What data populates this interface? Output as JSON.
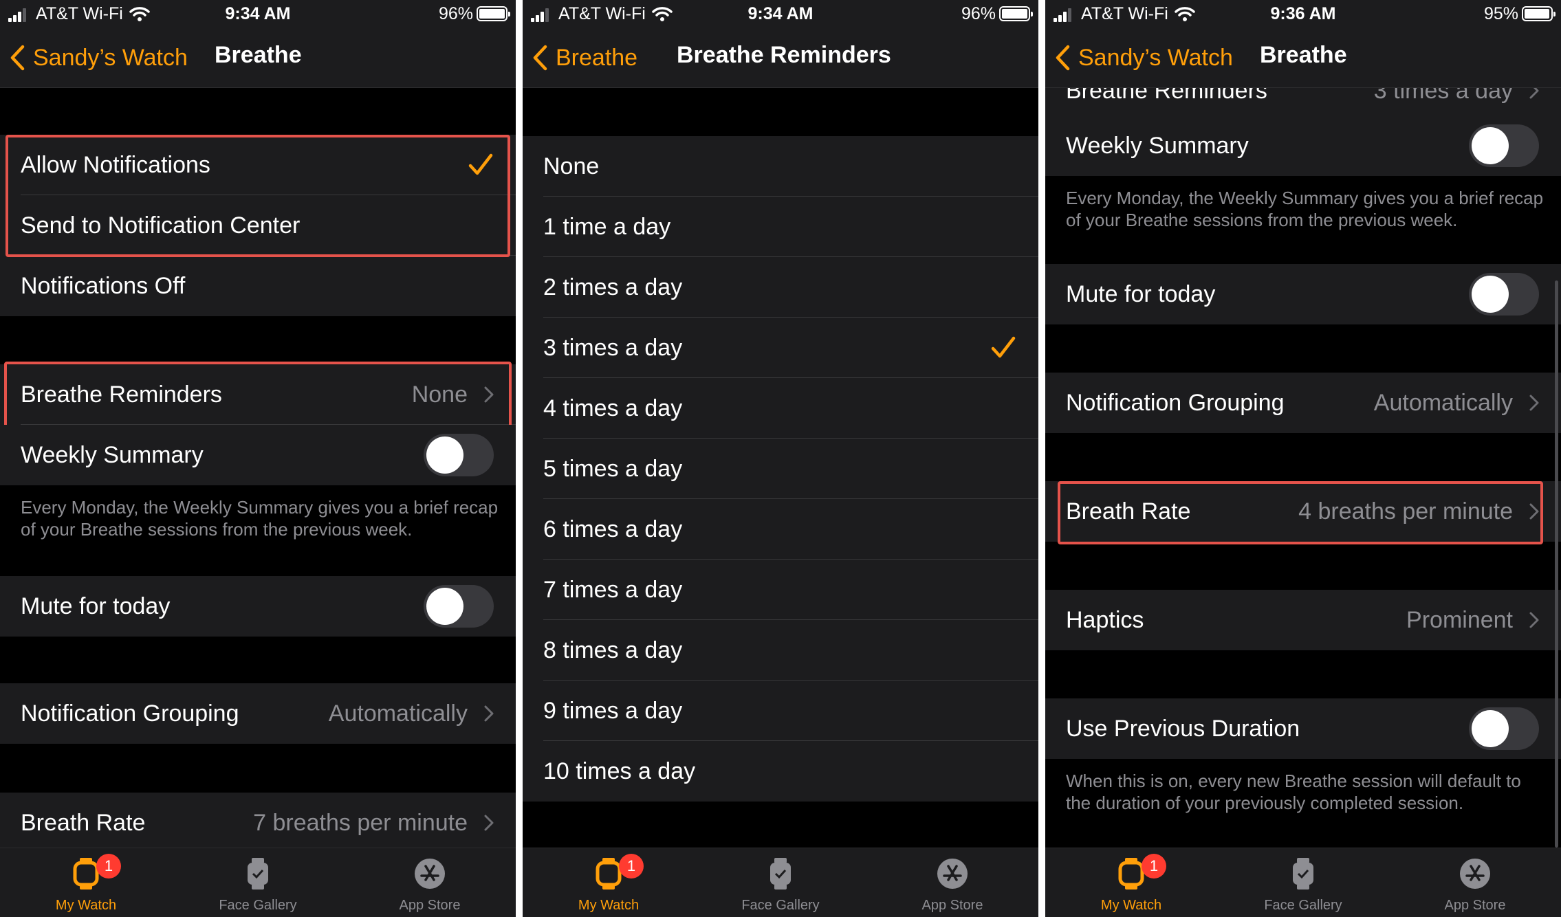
{
  "accent_color": "#ff9f0a",
  "highlight_color": "#e5534b",
  "screens": [
    {
      "status": {
        "carrier": "AT&T Wi-Fi",
        "time": "9:34 AM",
        "battery": "96%",
        "battery_level": 0.96
      },
      "nav": {
        "back_label": "Sandy’s Watch",
        "title": "Breathe"
      },
      "rows": {
        "allow_notifications": "Allow Notifications",
        "send_to_center": "Send to Notification Center",
        "notifications_off": "Notifications Off",
        "breathe_reminders": {
          "label": "Breathe Reminders",
          "value": "None"
        },
        "weekly_summary": {
          "label": "Weekly Summary",
          "on": false
        },
        "weekly_footnote": "Every Monday, the Weekly Summary gives you a brief recap of your Breathe sessions from the previous week.",
        "mute_today": {
          "label": "Mute for today",
          "on": false
        },
        "notification_grouping": {
          "label": "Notification Grouping",
          "value": "Automatically"
        },
        "breath_rate": {
          "label": "Breath Rate",
          "value": "7 breaths per minute"
        }
      }
    },
    {
      "status": {
        "carrier": "AT&T Wi-Fi",
        "time": "9:34 AM",
        "battery": "96%",
        "battery_level": 0.96
      },
      "nav": {
        "back_label": "Breathe",
        "title": "Breathe Reminders"
      },
      "options": [
        "None",
        "1 time a day",
        "2 times a day",
        "3 times a day",
        "4 times a day",
        "5 times a day",
        "6 times a day",
        "7 times a day",
        "8 times a day",
        "9 times a day",
        "10 times a day"
      ],
      "selected_option": "3 times a day"
    },
    {
      "status": {
        "carrier": "AT&T Wi-Fi",
        "time": "9:36 AM",
        "battery": "95%",
        "battery_level": 0.95
      },
      "nav": {
        "back_label": "Sandy’s Watch",
        "title": "Breathe"
      },
      "rows": {
        "breathe_reminders": {
          "label": "Breathe Reminders",
          "value": "3 times a day"
        },
        "weekly_summary": {
          "label": "Weekly Summary",
          "on": false
        },
        "weekly_footnote": "Every Monday, the Weekly Summary gives you a brief recap of your Breathe sessions from the previous week.",
        "mute_today": {
          "label": "Mute for today",
          "on": false
        },
        "notification_grouping": {
          "label": "Notification Grouping",
          "value": "Automatically"
        },
        "breath_rate": {
          "label": "Breath Rate",
          "value": "4 breaths per minute"
        },
        "haptics": {
          "label": "Haptics",
          "value": "Prominent"
        },
        "use_previous_duration": {
          "label": "Use Previous Duration",
          "on": false
        },
        "duration_footnote": "When this is on, every new Breathe session will default to the duration of your previously completed session."
      }
    }
  ],
  "tab_bar": {
    "items": [
      {
        "label": "My Watch",
        "icon": "watch-icon",
        "active": true,
        "badge": "1"
      },
      {
        "label": "Face Gallery",
        "icon": "face-gallery-icon",
        "active": false
      },
      {
        "label": "App Store",
        "icon": "app-store-icon",
        "active": false
      }
    ]
  }
}
